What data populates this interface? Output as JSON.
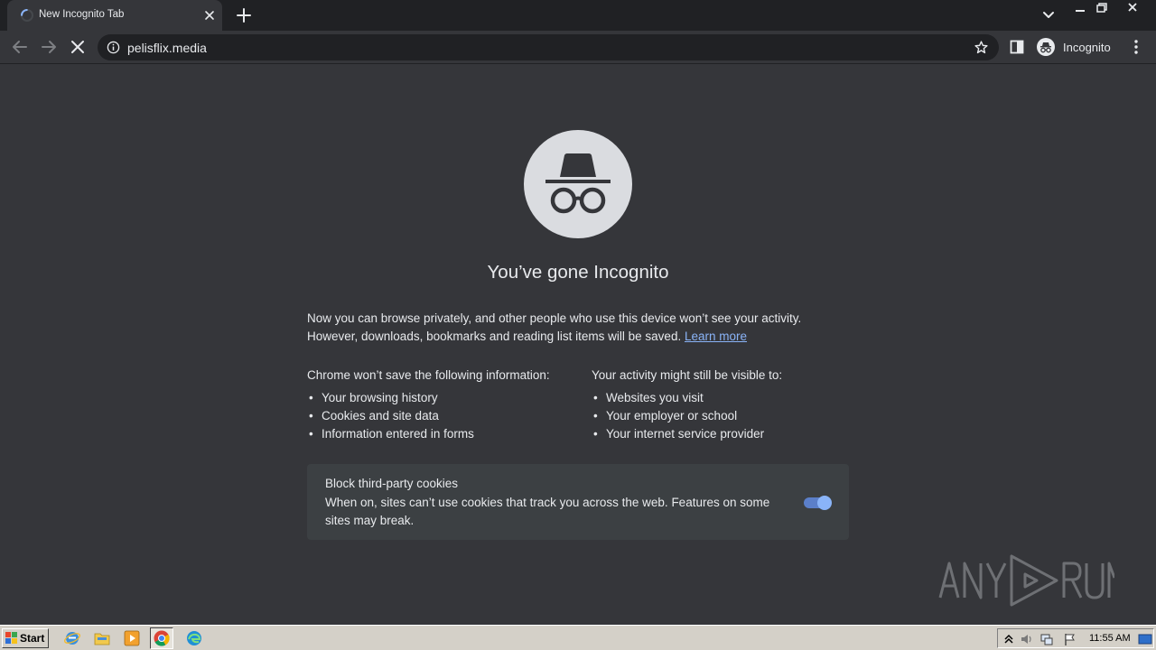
{
  "browser": {
    "tab": {
      "title": "New Incognito Tab",
      "loading": true
    },
    "omnibox": {
      "url": "pelisflix.media"
    },
    "profile": {
      "label": "Incognito"
    }
  },
  "page": {
    "headline": "You’ve gone Incognito",
    "intro_text": "Now you can browse privately, and other people who use this device won’t see your activity. However, downloads, bookmarks and reading list items will be saved.",
    "learn_more": "Learn more",
    "not_saved": {
      "title": "Chrome won’t save the following information:",
      "items": [
        "Your browsing history",
        "Cookies and site data",
        "Information entered in forms"
      ]
    },
    "visible_to": {
      "title": "Your activity might still be visible to:",
      "items": [
        "Websites you visit",
        "Your employer or school",
        "Your internet service provider"
      ]
    },
    "cookies": {
      "title": "Block third-party cookies",
      "description": "When on, sites can’t use cookies that track you across the web. Features on some sites may break.",
      "enabled": true
    }
  },
  "watermark": {
    "text": "ANY RUN"
  },
  "taskbar": {
    "start_label": "Start",
    "clock": "11:55 AM",
    "apps": [
      "internet-explorer-icon",
      "file-explorer-icon",
      "media-player-icon",
      "chrome-icon",
      "edge-icon"
    ]
  },
  "colors": {
    "page_bg": "#35363a",
    "tabstrip_bg": "#202124",
    "text": "#e8eaed",
    "link": "#8ab4f8",
    "card_bg": "#3c4043"
  }
}
